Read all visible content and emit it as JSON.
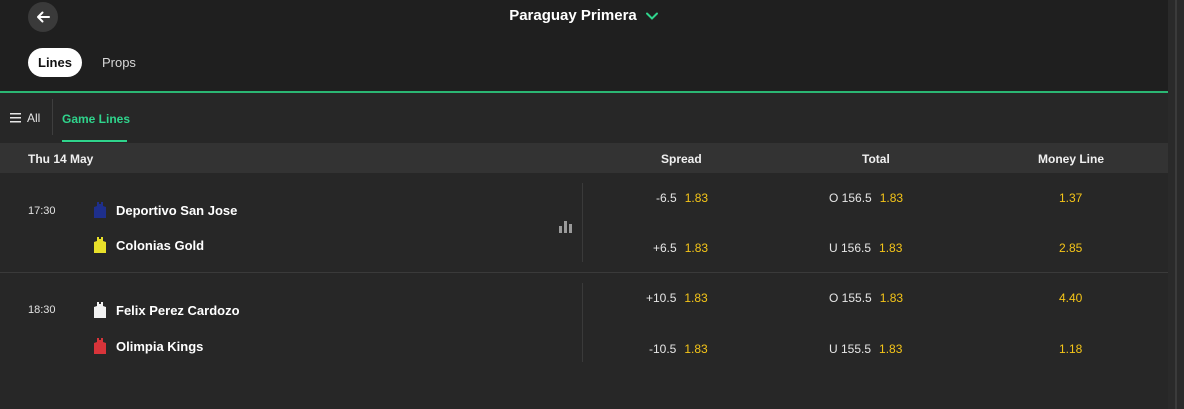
{
  "header": {
    "title": "Paraguay Primera",
    "tabs": [
      {
        "label": "Lines",
        "active": true
      },
      {
        "label": "Props",
        "active": false
      }
    ]
  },
  "filters": {
    "all_label": "All",
    "active_tab": "Game Lines"
  },
  "columns": {
    "date": "Thu 14 May",
    "spread": "Spread",
    "total": "Total",
    "moneyline": "Money Line"
  },
  "events": [
    {
      "time": "17:30",
      "teams": [
        {
          "name": "Deportivo San Jose",
          "jersey_color": "#1e2f8c"
        },
        {
          "name": "Colonias Gold",
          "jersey_color": "#e8e02a"
        }
      ],
      "spread": [
        {
          "line": "-6.5",
          "price": "1.83"
        },
        {
          "line": "+6.5",
          "price": "1.83"
        }
      ],
      "total": [
        {
          "line": "O 156.5",
          "price": "1.83"
        },
        {
          "line": "U 156.5",
          "price": "1.83"
        }
      ],
      "moneyline": [
        "1.37",
        "2.85"
      ]
    },
    {
      "time": "18:30",
      "teams": [
        {
          "name": "Felix Perez Cardozo",
          "jersey_color": "#f2f2f2"
        },
        {
          "name": "Olimpia Kings",
          "jersey_color": "#d8343a"
        }
      ],
      "spread": [
        {
          "line": "+10.5",
          "price": "1.83"
        },
        {
          "line": "-10.5",
          "price": "1.83"
        }
      ],
      "total": [
        {
          "line": "O 155.5",
          "price": "1.83"
        },
        {
          "line": "U 155.5",
          "price": "1.83"
        }
      ],
      "moneyline": [
        "4.40",
        "1.18"
      ]
    }
  ],
  "colors": {
    "accent": "#2fd48c",
    "price": "#f5c518",
    "background": "#272727"
  },
  "icons": [
    "back-arrow-icon",
    "chevron-down-icon",
    "menu-lines-icon",
    "stats-bars-icon",
    "jersey-icon"
  ]
}
